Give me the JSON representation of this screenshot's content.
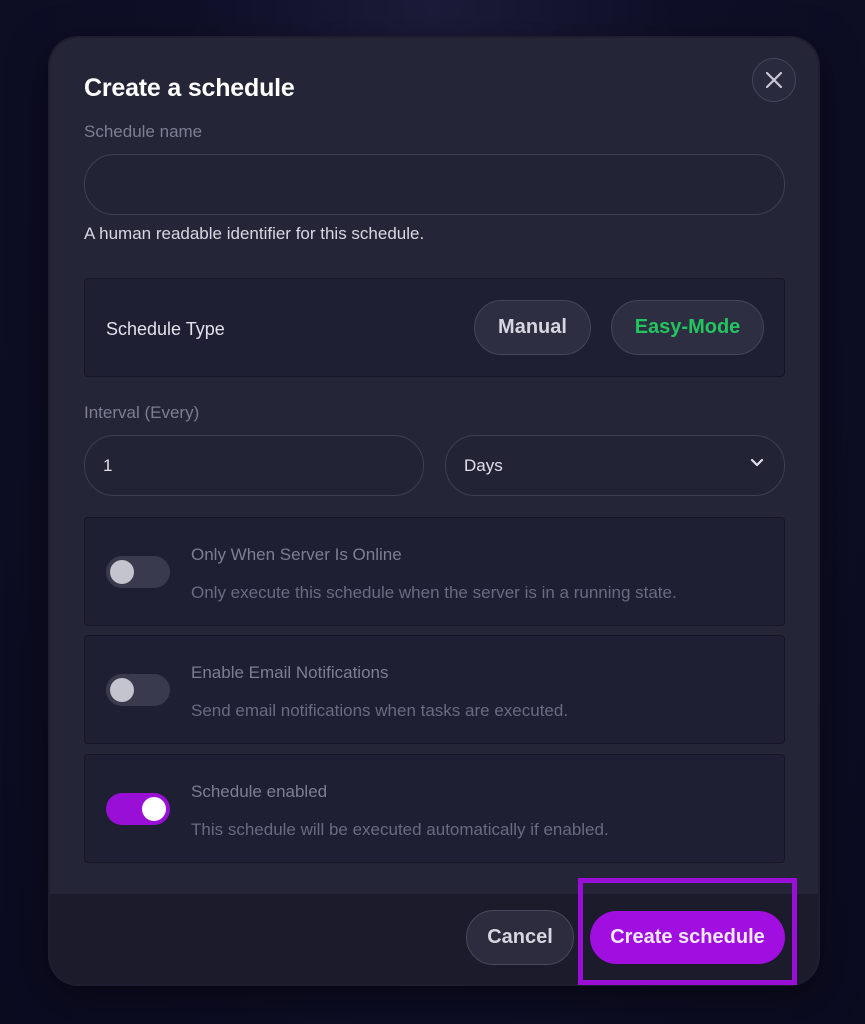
{
  "dialog": {
    "title": "Create a schedule"
  },
  "schedule_name": {
    "label": "Schedule name",
    "value": "",
    "placeholder": "",
    "helper": "A human readable identifier for this schedule."
  },
  "schedule_type": {
    "label": "Schedule Type",
    "options": [
      "Manual",
      "Easy-Mode"
    ],
    "selected": "Easy-Mode",
    "accent_color": "#22c55e"
  },
  "interval": {
    "label": "Interval (Every)",
    "value": "1",
    "unit": "Days"
  },
  "options": [
    {
      "title": "Only When Server Is Online",
      "description": "Only execute this schedule when the server is in a running state.",
      "enabled": false
    },
    {
      "title": "Enable Email Notifications",
      "description": "Send email notifications when tasks are executed.",
      "enabled": false
    },
    {
      "title": "Schedule enabled",
      "description": "This schedule will be executed automatically if enabled.",
      "enabled": true
    }
  ],
  "footer": {
    "cancel_label": "Cancel",
    "create_label": "Create schedule"
  },
  "colors": {
    "primary": "#a10fe0",
    "highlight": "#9a0fd6"
  }
}
